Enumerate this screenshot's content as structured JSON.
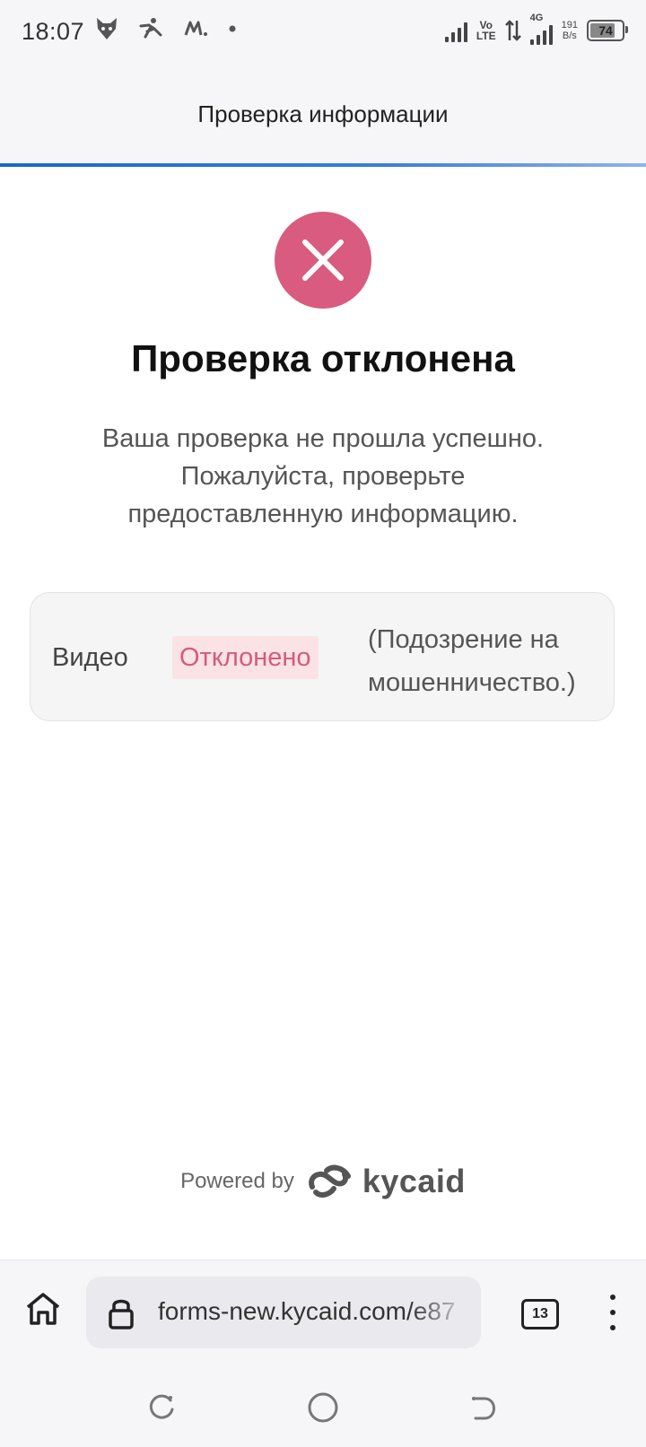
{
  "status_bar": {
    "time": "18:07",
    "network_label_top": "Vo",
    "network_label_bottom": "LTE",
    "network_type": "4G",
    "speed_value": "191",
    "speed_unit": "B/s",
    "battery_level": "74"
  },
  "header": {
    "title": "Проверка информации"
  },
  "result": {
    "title": "Проверка отклонена",
    "description": "Ваша проверка не прошла успешно. Пожалуйста, проверьте предоставленную информацию.",
    "icon": "close-icon",
    "icon_color": "#d95b7f"
  },
  "checks": [
    {
      "label": "Видео",
      "status": "Отклонено",
      "reason": "(Подозрение на мошенничество.)"
    }
  ],
  "footer": {
    "powered_by": "Powered by",
    "brand": "kycaid"
  },
  "browser": {
    "url": "forms-new.kycaid.com/e87",
    "tab_count": "13"
  },
  "colors": {
    "accent_blue": "#1966cc",
    "rejected_text": "#d65a7c",
    "rejected_bg": "#fbe3e5"
  }
}
